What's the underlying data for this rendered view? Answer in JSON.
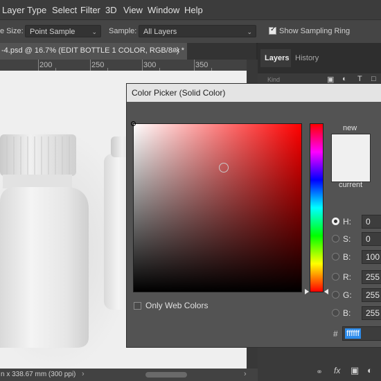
{
  "menubar": {
    "items": [
      "Layer",
      "Type",
      "Select",
      "Filter",
      "3D",
      "View",
      "Window",
      "Help"
    ]
  },
  "optionsbar": {
    "size_label_partial": "e Size:",
    "size_value": "Point Sample",
    "sample_label": "Sample:",
    "sample_value": "All Layers",
    "sampling_ring_label": "Show Sampling Ring",
    "sampling_ring_checked": true
  },
  "document": {
    "tab_title": "-4.psd @ 16.7% (EDIT BOTTLE 1 COLOR, RGB/8#) *",
    "close_glyph": "×",
    "ruler_numbers": [
      "200",
      "250",
      "300",
      "350"
    ],
    "status_text": "n x 338.67 mm (300 ppi)"
  },
  "panel": {
    "tabs": [
      "Layers",
      "History"
    ],
    "search_placeholder": "Kind"
  },
  "color_picker": {
    "title": "Color Picker (Solid Color)",
    "new_label": "new",
    "current_label": "current",
    "new_color": "#f0f0f0",
    "current_color": "#f0f0f0",
    "only_web_colors_label": "Only Web Colors",
    "only_web_colors_checked": false,
    "fields": [
      {
        "label": "H:",
        "value": "0",
        "selected": true
      },
      {
        "label": "S:",
        "value": "0",
        "selected": false
      },
      {
        "label": "B:",
        "value": "100",
        "selected": false
      },
      {
        "label": "R:",
        "value": "255",
        "selected": false
      },
      {
        "label": "G:",
        "value": "255",
        "selected": false
      },
      {
        "label": "B:",
        "value": "255",
        "selected": false
      }
    ],
    "hex_label": "#",
    "hex_value": "ffffff",
    "hue_color": "#ff0000"
  },
  "colors": {
    "accent": "#2d8ceb",
    "canvas_bg": "#efefef"
  }
}
